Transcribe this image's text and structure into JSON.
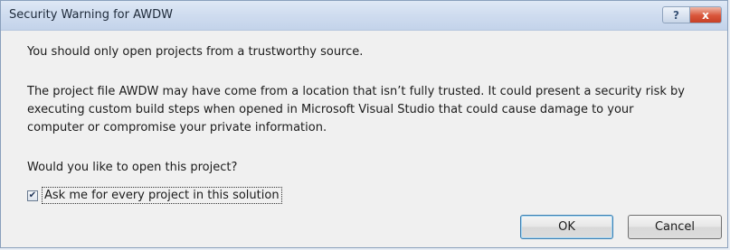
{
  "dialog": {
    "title": "Security Warning for AWDW",
    "help_glyph": "?",
    "close_glyph": "x"
  },
  "body": {
    "line1": "You should only open projects from a trustworthy source.",
    "paragraph": "The project file AWDW may have come from a location that isn’t fully trusted. It could present a security risk by executing custom build steps when opened in Microsoft Visual Studio that could cause damage to your computer or compromise your private information.",
    "question": "Would you like to open this project?"
  },
  "checkbox": {
    "label": "Ask me for every project in this solution",
    "checked": true,
    "check_glyph": "✔"
  },
  "buttons": {
    "ok": "OK",
    "cancel": "Cancel"
  },
  "colors": {
    "titlebar": "#c9d8ee",
    "close_button": "#d9553a",
    "ok_focus_border": "#3c7fb1"
  }
}
